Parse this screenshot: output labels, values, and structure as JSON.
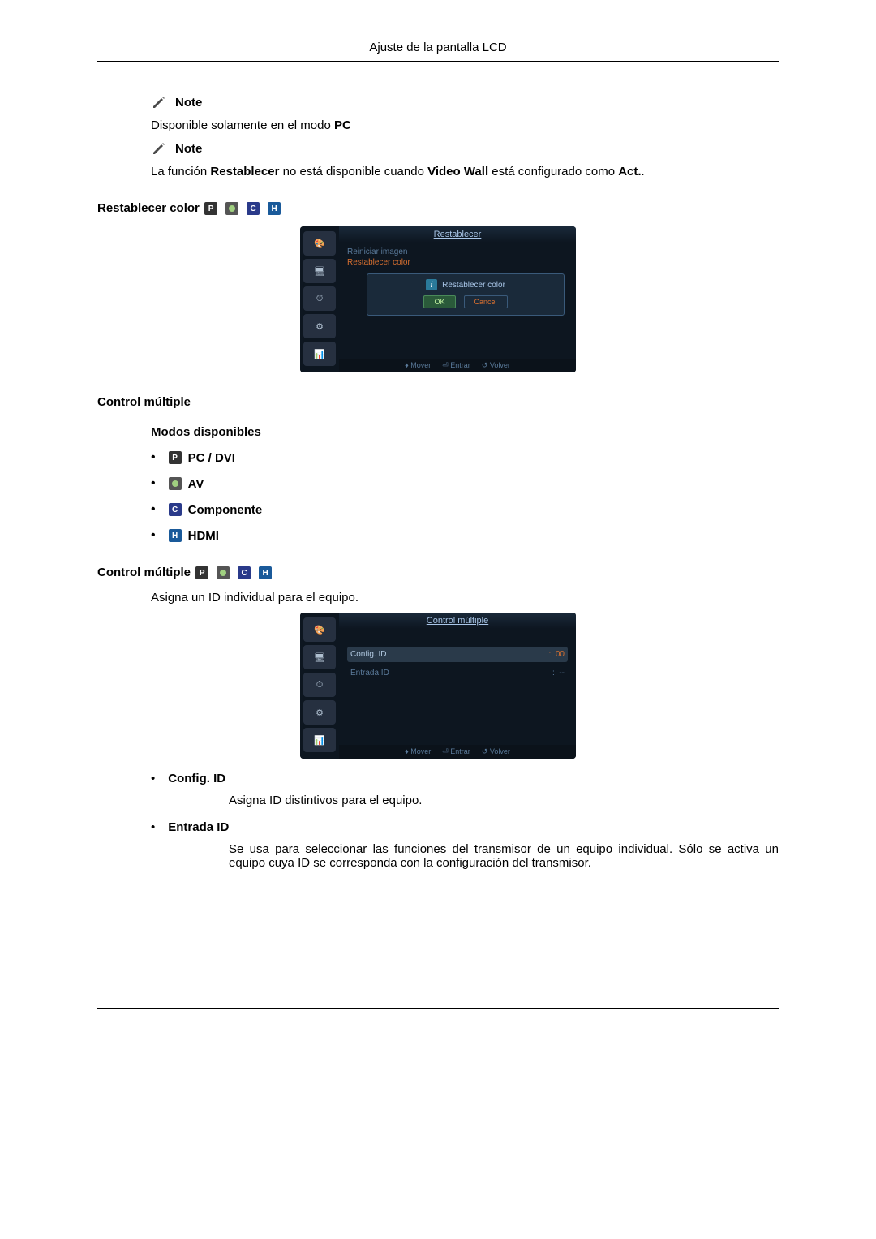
{
  "header": {
    "title": "Ajuste de la pantalla LCD"
  },
  "notes": {
    "label": "Note",
    "line1_a": "Disponible solamente en el modo ",
    "line1_b": "PC",
    "line2_a": "La función ",
    "line2_b": "Restablecer",
    "line2_c": " no está disponible cuando ",
    "line2_d": "Video Wall",
    "line2_e": " está configurado como ",
    "line2_f": "Act.",
    "line2_g": "."
  },
  "restablecer": {
    "title": "Restablecer color",
    "osd": {
      "title": "Restablecer",
      "item1": "Reiniciar imagen",
      "item2": "Restablecer color",
      "dialog_title": "Restablecer color",
      "ok": "OK",
      "cancel": "Cancel",
      "foot_mover": "Mover",
      "foot_entrar": "Entrar",
      "foot_volver": "Volver"
    }
  },
  "control_multiple": {
    "title": "Control múltiple",
    "modos_title": "Modos disponibles",
    "modes": {
      "pc": "PC / DVI",
      "av": "AV",
      "comp": "Componente",
      "hdmi": "HDMI"
    },
    "desc": "Asigna un ID individual para el equipo.",
    "osd": {
      "title": "Control múltiple",
      "row1_label": "Config. ID",
      "row1_value": "00",
      "row2_label": "Entrada ID",
      "row2_value": "--",
      "foot_mover": "Mover",
      "foot_entrar": "Entrar",
      "foot_volver": "Volver"
    },
    "config": {
      "title": "Config. ID",
      "body": "Asigna ID distintivos para el equipo."
    },
    "entrada": {
      "title": "Entrada ID",
      "body": "Se usa para seleccionar las funciones del transmisor de un equipo individual. Sólo se activa un equipo cuya ID se corresponda con la configuración del transmisor."
    }
  }
}
